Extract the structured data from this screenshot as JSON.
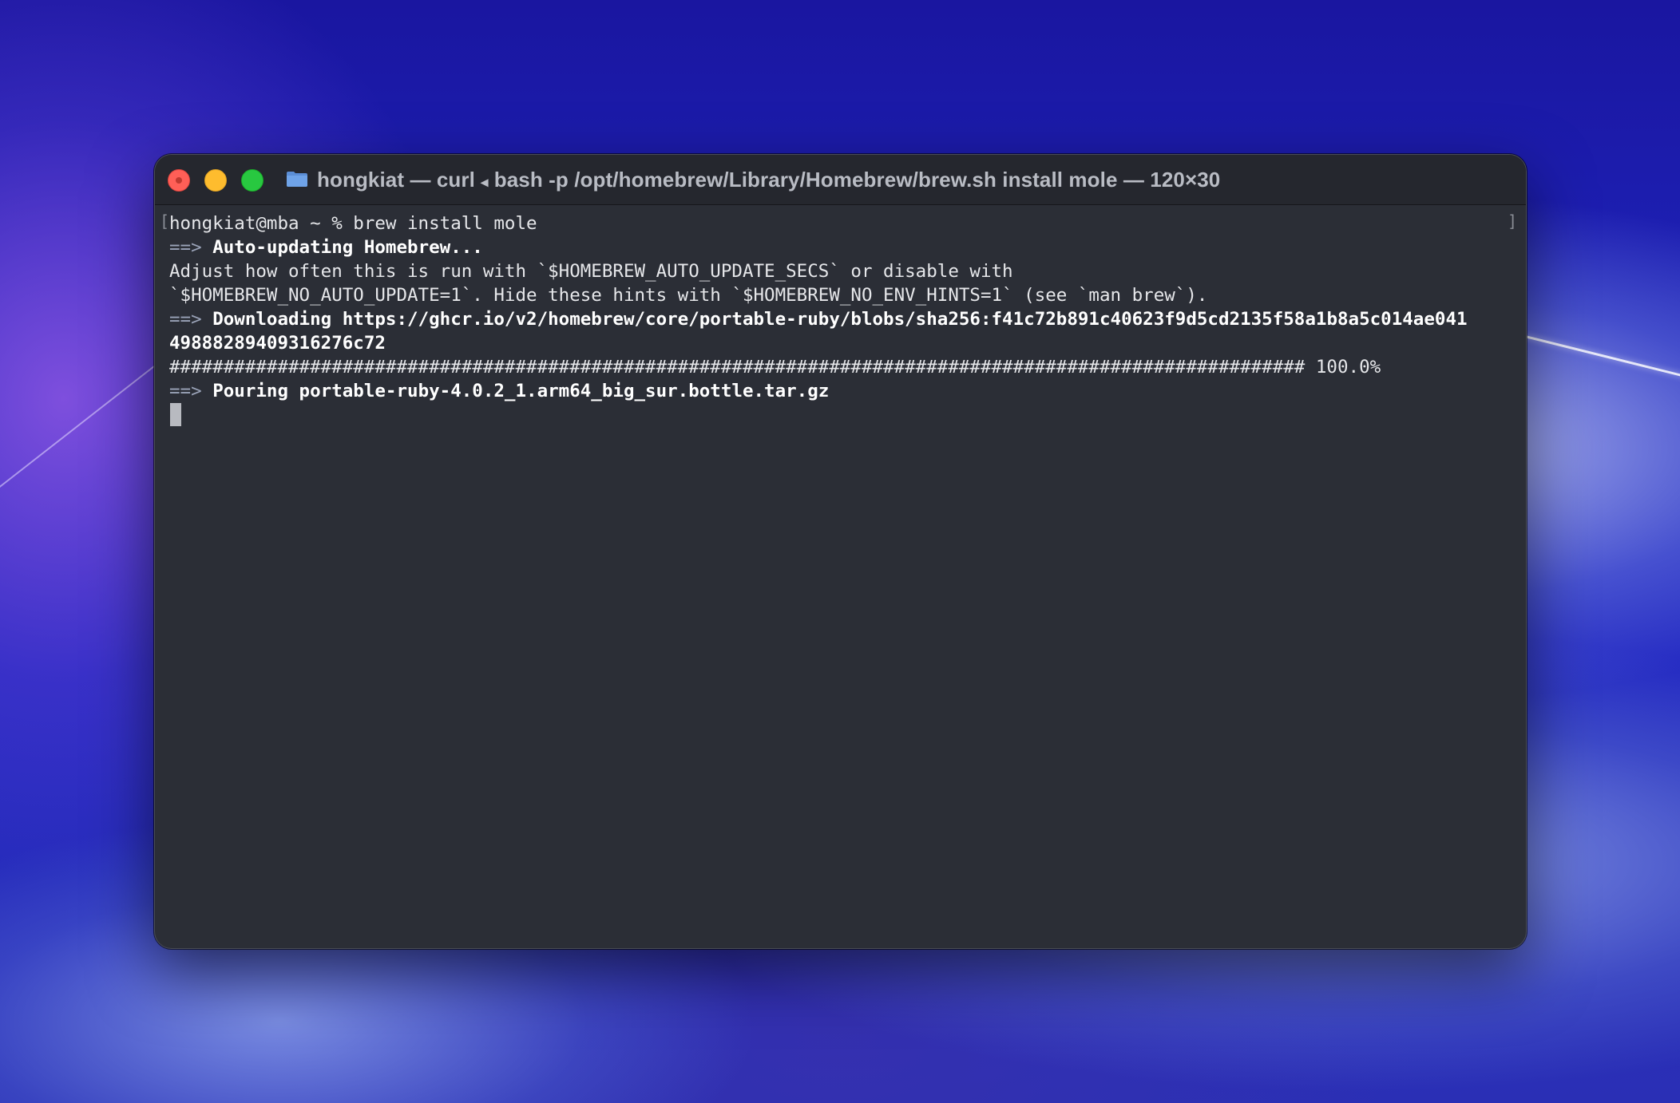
{
  "window": {
    "title_prefix": "hongkiat — curl",
    "title_separator": "◂",
    "title_suffix": "bash -p /opt/homebrew/Library/Homebrew/brew.sh install mole — 120×30"
  },
  "terminal": {
    "prompt_line": "hongkiat@mba ~ % brew install mole",
    "arrow": "==>",
    "line_auto_update": "Auto-updating Homebrew...",
    "line_adjust": "Adjust how often this is run with `$HOMEBREW_AUTO_UPDATE_SECS` or disable with",
    "line_hints": "`$HOMEBREW_NO_AUTO_UPDATE=1`. Hide these hints with `$HOMEBREW_NO_ENV_HINTS=1` (see `man brew`).",
    "line_downloading": "Downloading https://ghcr.io/v2/homebrew/core/portable-ruby/blobs/sha256:f41c72b891c40623f9d5cd2135f58a1b8a5c014ae041",
    "line_downloading_cont": "49888289409316276c72",
    "line_progress": "######################################################################################################### 100.0%",
    "line_pouring": "Pouring portable-ruby-4.0.2_1.arm64_big_sur.bottle.tar.gz",
    "bracket_left": "[",
    "bracket_right": "]"
  },
  "icons": {
    "folder": "folder-icon",
    "close": "close-icon",
    "minimize": "minimize-icon",
    "maximize": "maximize-icon"
  },
  "colors": {
    "close": "#ff5f57",
    "minimize": "#febc2e",
    "maximize": "#28c840",
    "terminal_bg": "#2b2e36"
  }
}
